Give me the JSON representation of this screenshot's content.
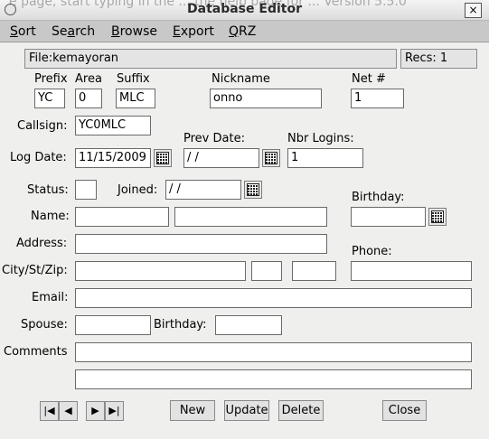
{
  "window": {
    "title": "Database Editor",
    "background_ghost_text": "e page, start typing in the ... the help page for ... Version 5.5.0",
    "close_glyph": "×"
  },
  "menu": {
    "sort": {
      "underlined": "S",
      "rest": "ort"
    },
    "search": {
      "first": "Se",
      "underlined": "a",
      "rest": "rch"
    },
    "browse": {
      "underlined": "B",
      "rest": "rowse"
    },
    "export": {
      "underlined": "E",
      "rest": "xport"
    },
    "qrz": {
      "underlined": "Q",
      "rest": "RZ"
    }
  },
  "status": {
    "file": "File:kemayoran",
    "recs": "Recs: 1"
  },
  "labels": {
    "prefix": "Prefix",
    "area": "Area",
    "suffix": "Suffix",
    "nickname": "Nickname",
    "net": "Net #",
    "callsign": "Callsign:",
    "log_date": "Log Date:",
    "prev_date": "Prev Date:",
    "nbr_logins": "Nbr Logins:",
    "status": "Status:",
    "joined": "Joined:",
    "birthday": "Birthday:",
    "name": "Name:",
    "address": "Address:",
    "phone": "Phone:",
    "city_st_zip": "City/St/Zip:",
    "email": "Email:",
    "spouse": "Spouse:",
    "spouse_birthday": "Birthday:",
    "comments": "Comments"
  },
  "values": {
    "prefix": "YC",
    "area": "0",
    "suffix": "MLC",
    "nickname": "onno",
    "net": "1",
    "callsign": "YC0MLC",
    "log_date": "11/15/2009",
    "prev_date": " /  /",
    "nbr_logins": "1",
    "status": "",
    "joined": " /  /",
    "birthday": "",
    "first_name": "",
    "last_name": "",
    "address": "",
    "phone": "",
    "city": "",
    "state": "",
    "zip": "",
    "email": "",
    "spouse": "",
    "spouse_birthday": "",
    "comments1": "",
    "comments2": ""
  },
  "buttons": {
    "new": "New",
    "update": "Update",
    "delete": "Delete",
    "close": "Close"
  },
  "nav": {
    "first": "|◀",
    "prev": "◀",
    "next": "▶",
    "last": "▶|"
  },
  "icons": {
    "calendar": "calendar-icon"
  }
}
